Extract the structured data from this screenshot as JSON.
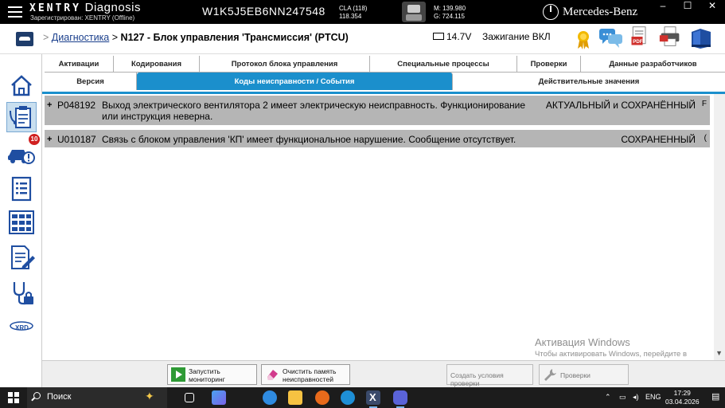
{
  "titlebar": {
    "app_brand": "XENTRY",
    "app_name": "Diagnosis",
    "registered": "Зарегистрирован: XENTRY (Offline)",
    "vin": "W1K5J5EB6NN247548",
    "model_line1": "CLA (118)",
    "model_line2": "118.354",
    "mileage_m": "M: 139.980",
    "mileage_g": "G: 724.115",
    "brand": "Mercedes-Benz",
    "minimize": "–",
    "maximize": "☐",
    "close": "✕"
  },
  "header": {
    "breadcrumb_arrow": ">",
    "breadcrumb_link": "Диагностика",
    "breadcrumb_sep": ">",
    "breadcrumb_current": "N127 - Блок управления 'Трансмиссия' (PTCU)",
    "voltage": "14.7V",
    "ignition": "Зажигание ВКЛ"
  },
  "sidebar": {
    "fault_badge": "10",
    "xrd_label": "XRD"
  },
  "tabs": {
    "row1": [
      "Активации",
      "Кодирования",
      "Протокол блока управления",
      "Специальные процессы",
      "Проверки",
      "Данные разработчиков"
    ],
    "row2": [
      "Версия",
      "Коды неисправности / События",
      "Действительные значения"
    ]
  },
  "faults": [
    {
      "expand": "+",
      "code": "P048192",
      "description": "Выход электрического вентилятора 2 имеет электрическую неисправность. Функционирование или инструкция неверна.",
      "status": "АКТУАЛЬНЫЙ и СОХРАНЁННЫЙ",
      "edge": "F"
    },
    {
      "expand": "+",
      "code": "U010187",
      "description": "Связь с блоком управления 'КП' имеет функциональное нарушение. Сообщение отсутствует.",
      "status": "СОХРАНЕННЫЙ",
      "edge": "("
    }
  ],
  "watermark": {
    "line1": "Активация Windows",
    "line2": "Чтобы активировать Windows, перейдите в"
  },
  "bottom_buttons": {
    "start_monitoring": "Запустить мониторинг",
    "clear_faults": "Очистить память неисправностей",
    "create_test_conditions": "Создать условия проверки",
    "checks": "Проверки"
  },
  "taskbar": {
    "search_label": "Поиск",
    "language": "ENG",
    "time": "17:29",
    "date": "03.04.2026"
  },
  "colors": {
    "accent": "#1b8fcc",
    "fault_row": "#b5b5b5",
    "title_bg": "#000000"
  }
}
